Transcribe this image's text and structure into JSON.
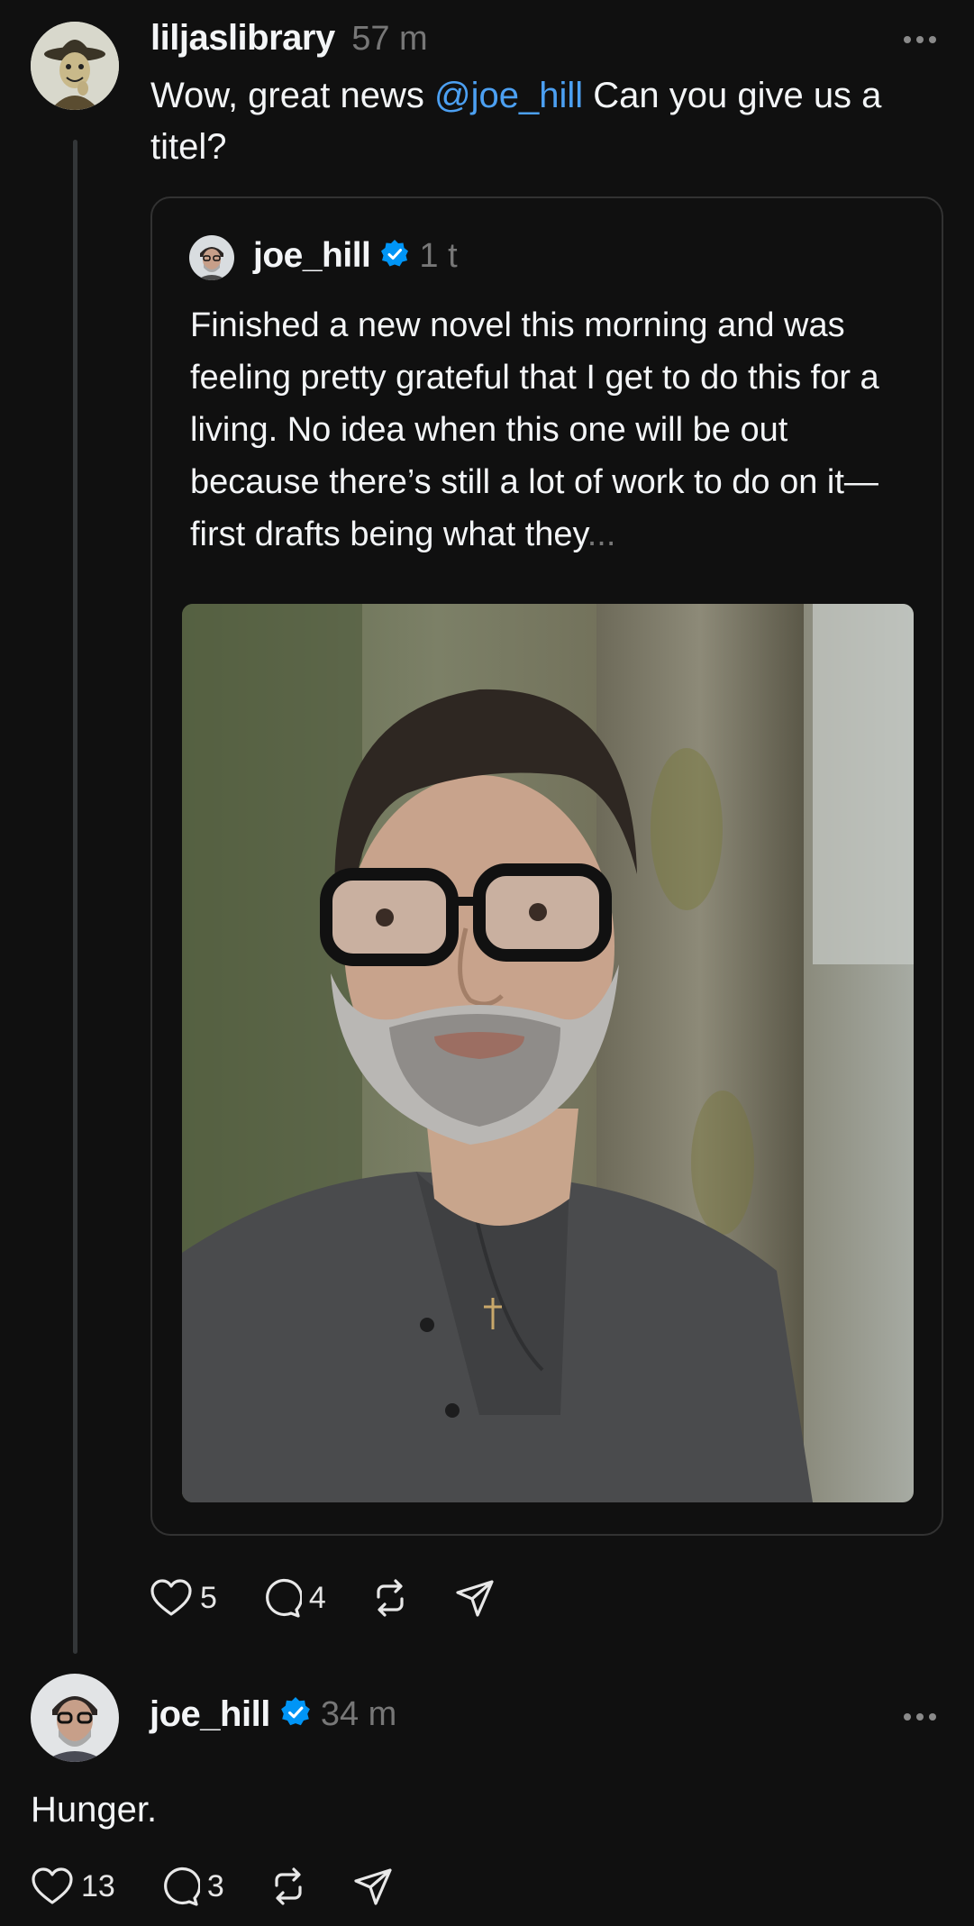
{
  "post": {
    "username": "liljaslibrary",
    "time": "57 m",
    "text_before": "Wow, great news ",
    "mention": "@joe_hill",
    "text_after": " Can you give us a titel?",
    "actions": {
      "likes": "5",
      "replies": "4"
    }
  },
  "quote": {
    "username": "joe_hill",
    "time": "1 t",
    "text": "Finished a new novel this morning and was feeling pretty grateful that I get to do this for a living. No idea when this one will be out because there’s still a lot of work to do on it—first drafts being what they",
    "ellipsis": "..."
  },
  "reply": {
    "username": "joe_hill",
    "time": "34 m",
    "text": "Hunger.",
    "actions": {
      "likes": "13",
      "replies": "3"
    }
  },
  "colors": {
    "background": "#101010",
    "mention": "#4ca0f2",
    "verified": "#0095f6",
    "muted": "#777777"
  },
  "icons": [
    "more-icon",
    "verified-icon",
    "heart-icon",
    "comment-icon",
    "repost-icon",
    "share-icon"
  ]
}
